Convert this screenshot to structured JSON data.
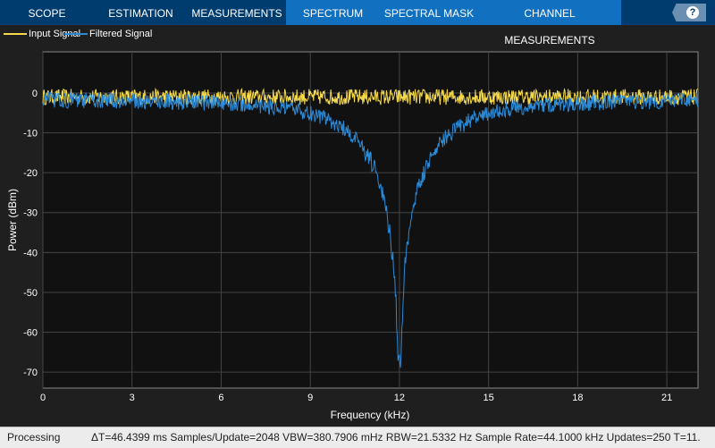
{
  "tabs": [
    {
      "label": "SCOPE"
    },
    {
      "label": "ESTIMATION"
    },
    {
      "label": "MEASUREMENTS"
    },
    {
      "label": "SPECTRUM"
    },
    {
      "label": "SPECTRAL MASK"
    },
    {
      "label": "CHANNEL MEASUREMENTS"
    }
  ],
  "help_label": "?",
  "status": {
    "state": "Processing",
    "info": "ΔT=46.4399 ms  Samples/Update=2048  VBW=380.7906 mHz  RBW=21.5332 Hz  Sample Rate=44.1000 kHz  Updates=250  T=11."
  },
  "chart_data": {
    "type": "line",
    "xlabel": "Frequency (kHz)",
    "ylabel": "Power (dBm)",
    "xlim": [
      0,
      22.05
    ],
    "ylim": [
      -74,
      10.3
    ],
    "xticks": [
      0,
      3,
      6,
      9,
      12,
      15,
      18,
      21
    ],
    "yticks": [
      0,
      -10,
      -20,
      -30,
      -40,
      -50,
      -60,
      -70
    ],
    "grid": true,
    "legend": "top-left",
    "series": [
      {
        "name": "Input Signal",
        "color": "#f5d94a",
        "model": "flat noise",
        "level_db": -1,
        "noise_db": 2.5
      },
      {
        "name": "Filtered Signal",
        "color": "#2a8ad8",
        "model": "notch",
        "level_db": -1.5,
        "noise_db": 2.5,
        "notch_center_khz": 12,
        "notch_min_db": -65,
        "bandwidth_khz": 2.2
      }
    ]
  }
}
